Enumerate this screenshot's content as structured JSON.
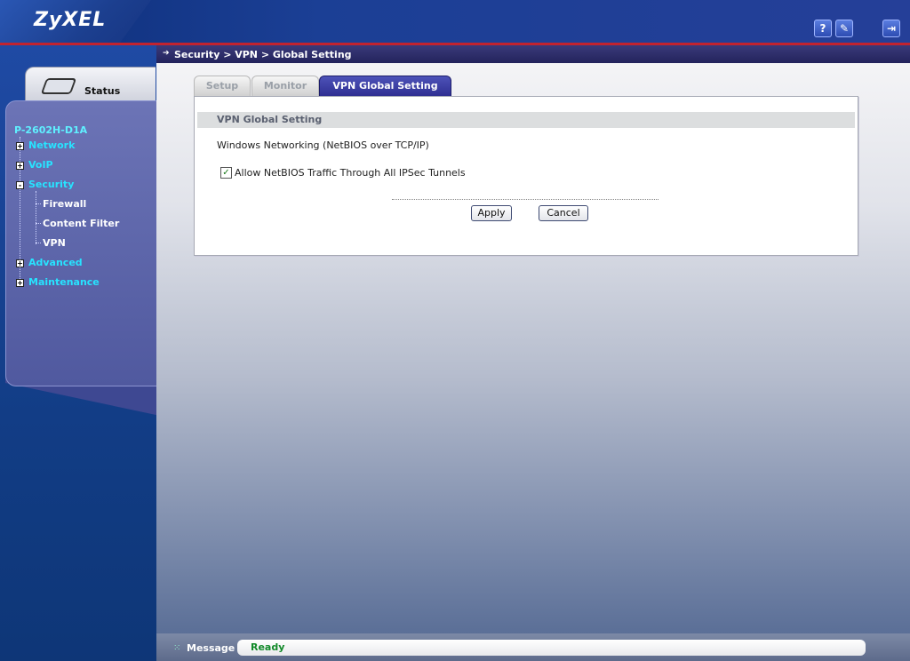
{
  "header": {
    "logo": "ZyXEL",
    "help_icon": "help-icon",
    "wizard_icon": "wizard-icon",
    "logout_icon": "logout-icon"
  },
  "sidebar": {
    "status_label": "Status",
    "device_name": "P-2602H-D1A",
    "items": [
      {
        "label": "Network",
        "expander": "+"
      },
      {
        "label": "VoIP",
        "expander": "+"
      },
      {
        "label": "Security",
        "expander": "-"
      },
      {
        "label": "Advanced",
        "expander": "+"
      },
      {
        "label": "Maintenance",
        "expander": "+"
      }
    ],
    "security_children": [
      "Firewall",
      "Content Filter",
      "VPN"
    ]
  },
  "breadcrumb": "Security > VPN > Global Setting",
  "tabs": [
    {
      "label": "Setup",
      "active": false
    },
    {
      "label": "Monitor",
      "active": false
    },
    {
      "label": "VPN Global Setting",
      "active": true
    }
  ],
  "panel": {
    "header": "VPN Global Setting",
    "section_label": "Windows Networking (NetBIOS over TCP/IP)",
    "checkbox_label": "Allow NetBIOS Traffic Through All IPSec Tunnels",
    "checkbox_checked": true,
    "checkmark": "✓",
    "apply_label": "Apply",
    "cancel_label": "Cancel"
  },
  "statusbar": {
    "label": "Message",
    "value": "Ready"
  },
  "colors": {
    "accent": "#2f2f92",
    "nav_text": "#27e3ff",
    "status_ready": "#138a2a"
  }
}
